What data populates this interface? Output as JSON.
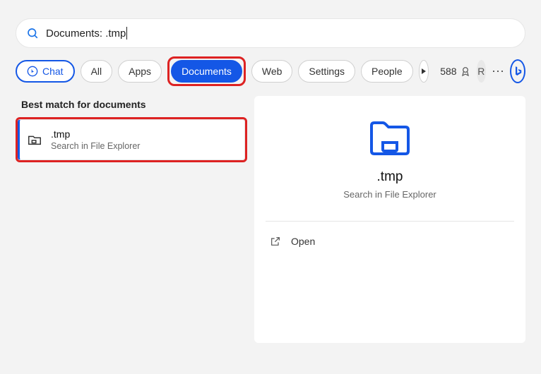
{
  "search": {
    "value": "Documents: .tmp"
  },
  "filters": {
    "chat": "Chat",
    "all": "All",
    "apps": "Apps",
    "documents": "Documents",
    "web": "Web",
    "settings": "Settings",
    "people": "People"
  },
  "points": {
    "count": "588"
  },
  "avatar": {
    "initial": "R"
  },
  "results": {
    "section_title": "Best match for documents",
    "item": {
      "title": ".tmp",
      "subtitle": "Search in File Explorer"
    }
  },
  "preview": {
    "title": ".tmp",
    "subtitle": "Search in File Explorer",
    "action_open": "Open"
  }
}
